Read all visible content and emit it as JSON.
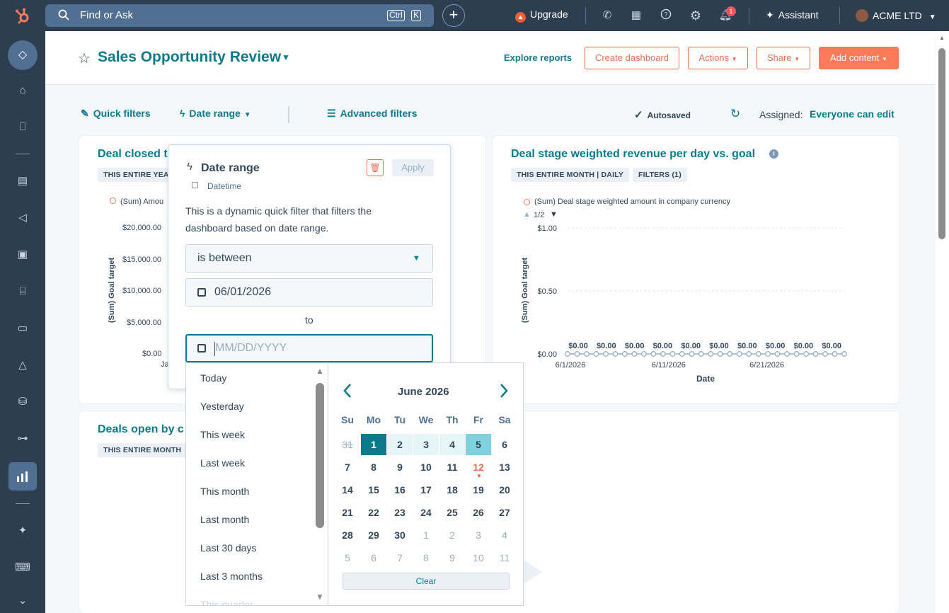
{
  "topbar": {
    "search_placeholder": "Find or Ask",
    "kbd_ctrl": "Ctrl",
    "kbd_k": "K",
    "upgrade_label": "Upgrade",
    "notification_count": "1",
    "assistant_label": "Assistant",
    "account_label": "ACME LTD"
  },
  "header": {
    "title": "Sales Opportunity Review",
    "explore_reports": "Explore reports",
    "create_dashboard": "Create dashboard",
    "actions": "Actions",
    "share": "Share",
    "add_content": "Add content"
  },
  "filterbar": {
    "quick_filters": "Quick filters",
    "date_range": "Date range",
    "advanced_filters": "Advanced filters",
    "autosaved": "Autosaved",
    "assigned_label": "Assigned:",
    "assigned_value": "Everyone can edit"
  },
  "card1": {
    "title": "Deal closed t",
    "chip": "THIS ENTIRE YEAR",
    "legend": "(Sum) Amou",
    "ylabel": "(Sum) Goal target",
    "yticks": [
      "$20,000.00",
      "$15,000.00",
      "$10,000.00",
      "$5,000.00",
      "$0.00"
    ],
    "xtick": "Ja"
  },
  "card2": {
    "title": "Deal stage weighted revenue per day vs. goal",
    "chip1": "THIS ENTIRE MONTH | DAILY",
    "chip2": "FILTERS (1)",
    "legend": "(Sum) Deal stage weighted amount in company currency",
    "pager": "1/2",
    "ylabel": "(Sum) Goal target",
    "xlabel": "Date"
  },
  "card3": {
    "title": "Deals open by c",
    "chip": "THIS ENTIRE MONTH"
  },
  "chart_data": {
    "type": "line",
    "title": "Deal stage weighted revenue per day vs. goal",
    "xlabel": "Date",
    "ylabel": "(Sum) Goal target",
    "ylim": [
      0,
      1
    ],
    "yticks": [
      "$1.00",
      "$0.50",
      "$0.00"
    ],
    "xticks": [
      "6/1/2026",
      "6/11/2026",
      "6/21/2026"
    ],
    "x": [
      "6/1/2026",
      "6/2/2026",
      "6/3/2026",
      "6/4/2026",
      "6/5/2026",
      "6/6/2026",
      "6/7/2026",
      "6/8/2026",
      "6/9/2026",
      "6/10/2026",
      "6/11/2026",
      "6/12/2026",
      "6/13/2026",
      "6/14/2026",
      "6/15/2026",
      "6/16/2026",
      "6/17/2026",
      "6/18/2026",
      "6/19/2026",
      "6/20/2026",
      "6/21/2026",
      "6/22/2026",
      "6/23/2026",
      "6/24/2026",
      "6/25/2026",
      "6/26/2026",
      "6/27/2026",
      "6/28/2026",
      "6/29/2026",
      "6/30/2026"
    ],
    "series": [
      {
        "name": "(Sum) Deal stage weighted amount in company currency",
        "values": [
          0,
          0,
          0,
          0,
          0,
          0,
          0,
          0,
          0,
          0,
          0,
          0,
          0,
          0,
          0,
          0,
          0,
          0,
          0,
          0,
          0,
          0,
          0,
          0,
          0,
          0,
          0,
          0,
          0,
          0
        ]
      }
    ],
    "value_labels": [
      "$0.00",
      "$0.00",
      "$0.00",
      "$0.00",
      "$0.00",
      "$0.00",
      "$0.00",
      "$0.00",
      "$0.00",
      "$0.00"
    ],
    "grid": true,
    "legend": "top-left"
  },
  "popover": {
    "title": "Date range",
    "subtitle": "Datetime",
    "apply": "Apply",
    "description": "This is a dynamic quick filter that filters the dashboard based on date range.",
    "operator": "is between",
    "start_date": "06/01/2026",
    "to_label": "to",
    "end_placeholder": "MM/DD/YYYY"
  },
  "presets": [
    "Today",
    "Yesterday",
    "This week",
    "Last week",
    "This month",
    "Last month",
    "Last 30 days",
    "Last 3 months",
    "This quarter"
  ],
  "calendar": {
    "month_label": "June 2026",
    "dow": [
      "Su",
      "Mo",
      "Tu",
      "We",
      "Th",
      "Fr",
      "Sa"
    ],
    "weeks": [
      [
        "31",
        "1",
        "2",
        "3",
        "4",
        "5",
        "6"
      ],
      [
        "7",
        "8",
        "9",
        "10",
        "11",
        "12",
        "13"
      ],
      [
        "14",
        "15",
        "16",
        "17",
        "18",
        "19",
        "20"
      ],
      [
        "21",
        "22",
        "23",
        "24",
        "25",
        "26",
        "27"
      ],
      [
        "28",
        "29",
        "30",
        "1",
        "2",
        "3",
        "4"
      ],
      [
        "5",
        "6",
        "7",
        "8",
        "9",
        "10",
        "11"
      ]
    ],
    "clear": "Clear"
  }
}
